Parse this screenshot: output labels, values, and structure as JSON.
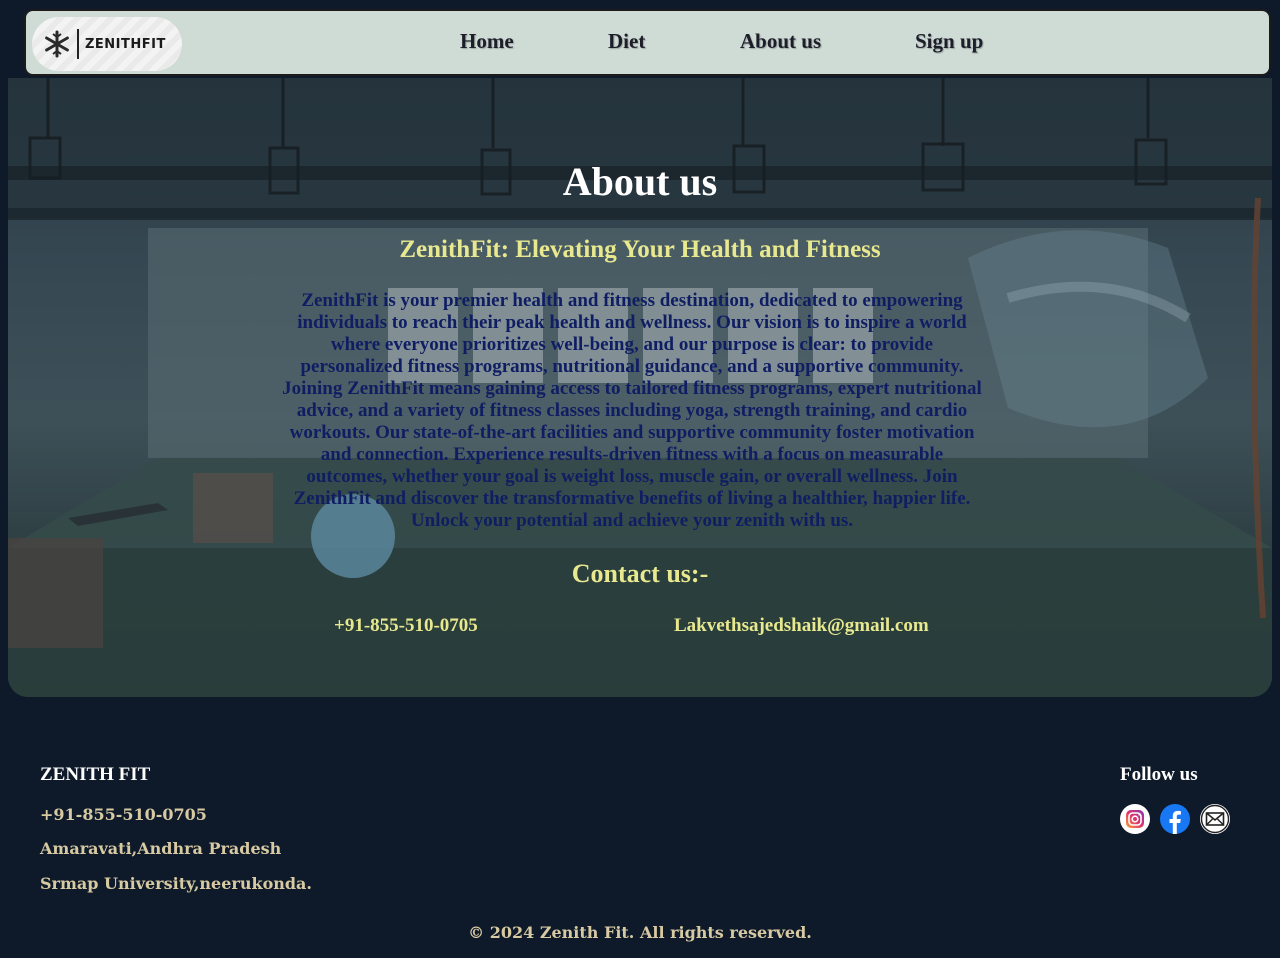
{
  "brand": {
    "logo_text": "ZENITHFIT",
    "logo_icon": "snowflake-icon"
  },
  "nav": {
    "items": [
      {
        "label": "Home"
      },
      {
        "label": "Diet"
      },
      {
        "label": "About us"
      },
      {
        "label": "Sign up"
      }
    ]
  },
  "hero": {
    "title": "About us",
    "subtitle": "ZenithFit: Elevating Your Health and Fitness",
    "paragraph": "ZenithFit is your premier health and fitness destination, dedicated to empowering individuals to reach their peak health and wellness. Our vision is to inspire a world where everyone prioritizes well-being, and our purpose is clear: to provide personalized fitness programs, nutritional guidance, and a supportive community. Joining ZenithFit means gaining access to tailored fitness programs, expert nutritional advice, and a variety of fitness classes including yoga, strength training, and cardio workouts. Our state-of-the-art facilities and supportive community foster motivation and connection. Experience results-driven fitness with a focus on measurable outcomes, whether your goal is weight loss, muscle gain, or overall wellness. Join ZenithFit and discover the transformative benefits of living a healthier, happier life. Unlock your potential and achieve your zenith with us.",
    "contact_title": "Contact us:-",
    "phone": "+91-855-510-0705",
    "email": "Lakvethsajedshaik@gmail.com"
  },
  "footer": {
    "brand": "ZENITH FIT",
    "phone": "+91-855-510-0705",
    "address_line1": "Amaravati,Andhra Pradesh",
    "address_line2": "Srmap University,neerukonda.",
    "follow_label": "Follow us",
    "social": [
      "instagram-icon",
      "facebook-icon",
      "mail-icon"
    ],
    "copyright": "© 2024 Zenith Fit. All rights reserved."
  },
  "colors": {
    "nav_bg": "#cfdcd6",
    "page_bg": "#0e1a2a",
    "accent_yellow": "#e8e88f",
    "paragraph_navy": "#0f1d63",
    "footer_text": "#d7c9a2"
  }
}
